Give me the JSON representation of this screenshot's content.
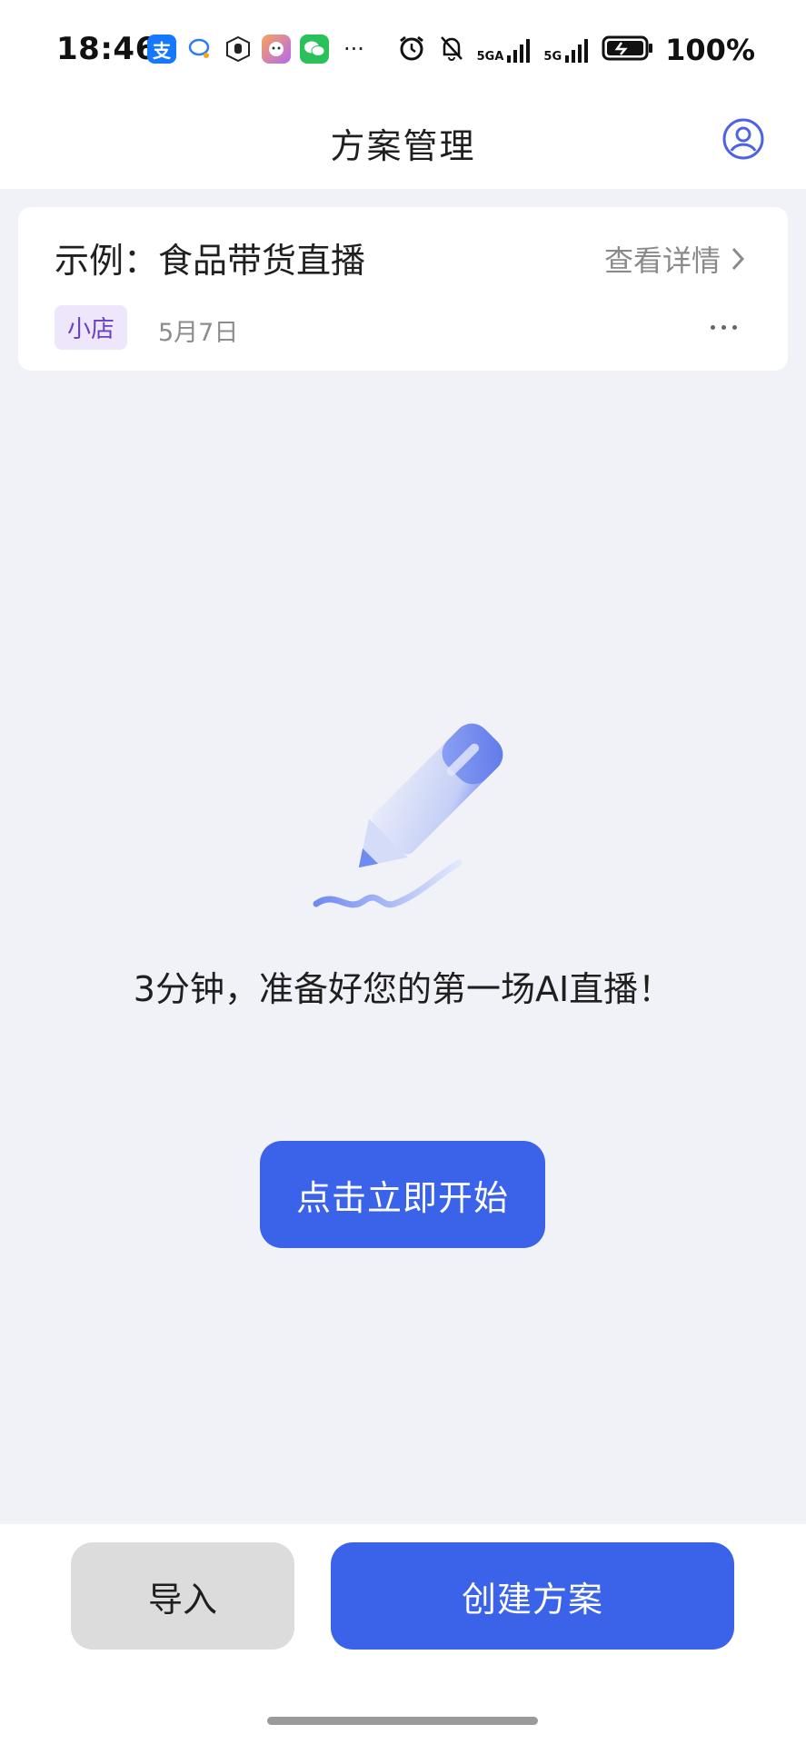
{
  "status_bar": {
    "time": "18:46",
    "more": "···",
    "network_1": "5GA",
    "network_2": "5G",
    "battery": "100%",
    "icons": [
      "alipay-icon",
      "message-bubble-icon",
      "hand-icon",
      "avatar-app-icon",
      "wechat-icon",
      "alarm-icon",
      "bell-muted-icon",
      "signal-icon",
      "battery-icon"
    ]
  },
  "header": {
    "title": "方案管理",
    "profile_icon": "user-circle-icon"
  },
  "plan_card": {
    "title": "示例：食品带货直播",
    "detail_link": "查看详情",
    "tag": "小店",
    "date": "5月7日"
  },
  "empty_state": {
    "illustration": "pencil-icon",
    "message": "3分钟，准备好您的第一场AI直播！",
    "start_button": "点击立即开始"
  },
  "bottom_bar": {
    "import_button": "导入",
    "create_button": "创建方案"
  },
  "colors": {
    "accent": "#3b63ea",
    "background": "#f1f2f8",
    "tag_bg": "#eee6fb",
    "tag_text": "#6a3fc4"
  }
}
